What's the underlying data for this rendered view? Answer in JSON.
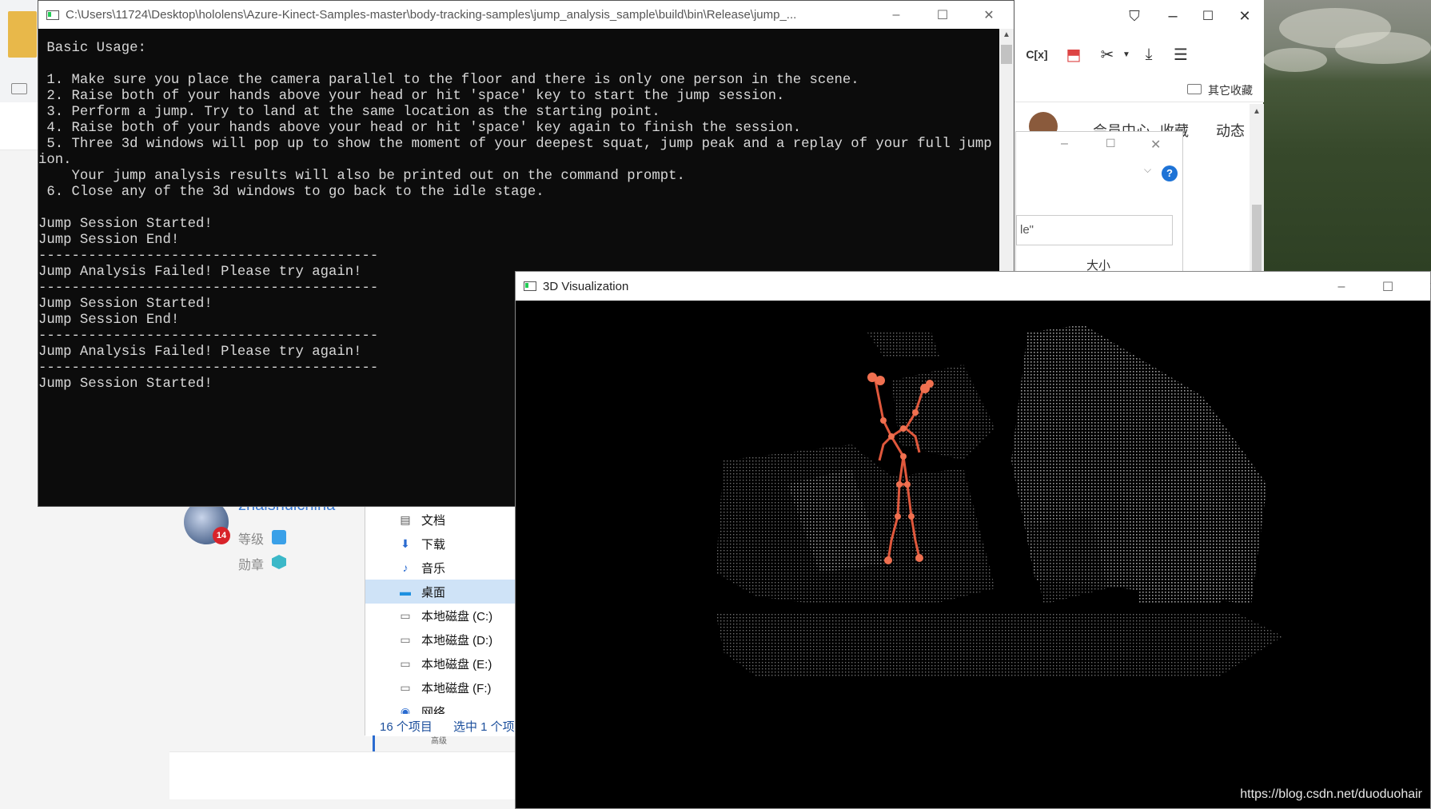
{
  "console": {
    "title": "C:\\Users\\11724\\Desktop\\hololens\\Azure-Kinect-Samples-master\\body-tracking-samples\\jump_analysis_sample\\build\\bin\\Release\\jump_...",
    "lines": [
      " Basic Usage:",
      "",
      " 1. Make sure you place the camera parallel to the floor and there is only one person in the scene.",
      " 2. Raise both of your hands above your head or hit 'space' key to start the jump session.",
      " 3. Perform a jump. Try to land at the same location as the starting point.",
      " 4. Raise both of your hands above your head or hit 'space' key again to finish the session.",
      " 5. Three 3d windows will pop up to show the moment of your deepest squat, jump peak and a replay of your full jump sess",
      "ion.",
      "    Your jump analysis results will also be printed out on the command prompt.",
      " 6. Close any of the 3d windows to go back to the idle stage.",
      "",
      "Jump Session Started!",
      "Jump Session End!",
      "-----------------------------------------",
      "Jump Analysis Failed! Please try again!",
      "-----------------------------------------",
      "Jump Session Started!",
      "Jump Session End!",
      "-----------------------------------------",
      "Jump Analysis Failed! Please try again!",
      "-----------------------------------------",
      "Jump Session Started!"
    ]
  },
  "viz": {
    "title": "3D Visualization"
  },
  "browser": {
    "bookmark_label": "其它收藏",
    "nav_items": [
      "会员中心",
      "收藏",
      "动态"
    ],
    "dialog_input_fragment": "le\"",
    "dialog_col_header": "大小"
  },
  "profile": {
    "username": "zhaishuichina",
    "level_label": "等级",
    "badge_label": "勋章",
    "avatar_badge": "14"
  },
  "explorer": {
    "items": [
      {
        "label": "文档",
        "icon": "document-icon"
      },
      {
        "label": "下载",
        "icon": "download-icon"
      },
      {
        "label": "音乐",
        "icon": "music-icon"
      },
      {
        "label": "桌面",
        "icon": "desktop-icon",
        "selected": true
      },
      {
        "label": "本地磁盘 (C:)",
        "icon": "drive-icon"
      },
      {
        "label": "本地磁盘 (D:)",
        "icon": "drive-icon"
      },
      {
        "label": "本地磁盘 (E:)",
        "icon": "drive-icon"
      },
      {
        "label": "本地磁盘 (F:)",
        "icon": "drive-icon"
      },
      {
        "label": "网络",
        "icon": "network-icon"
      }
    ],
    "status_count": "16 个项目",
    "status_selected": "选中 1 个项",
    "sub_label": "高级"
  },
  "watermark": "https://blog.csdn.net/duoduohair"
}
